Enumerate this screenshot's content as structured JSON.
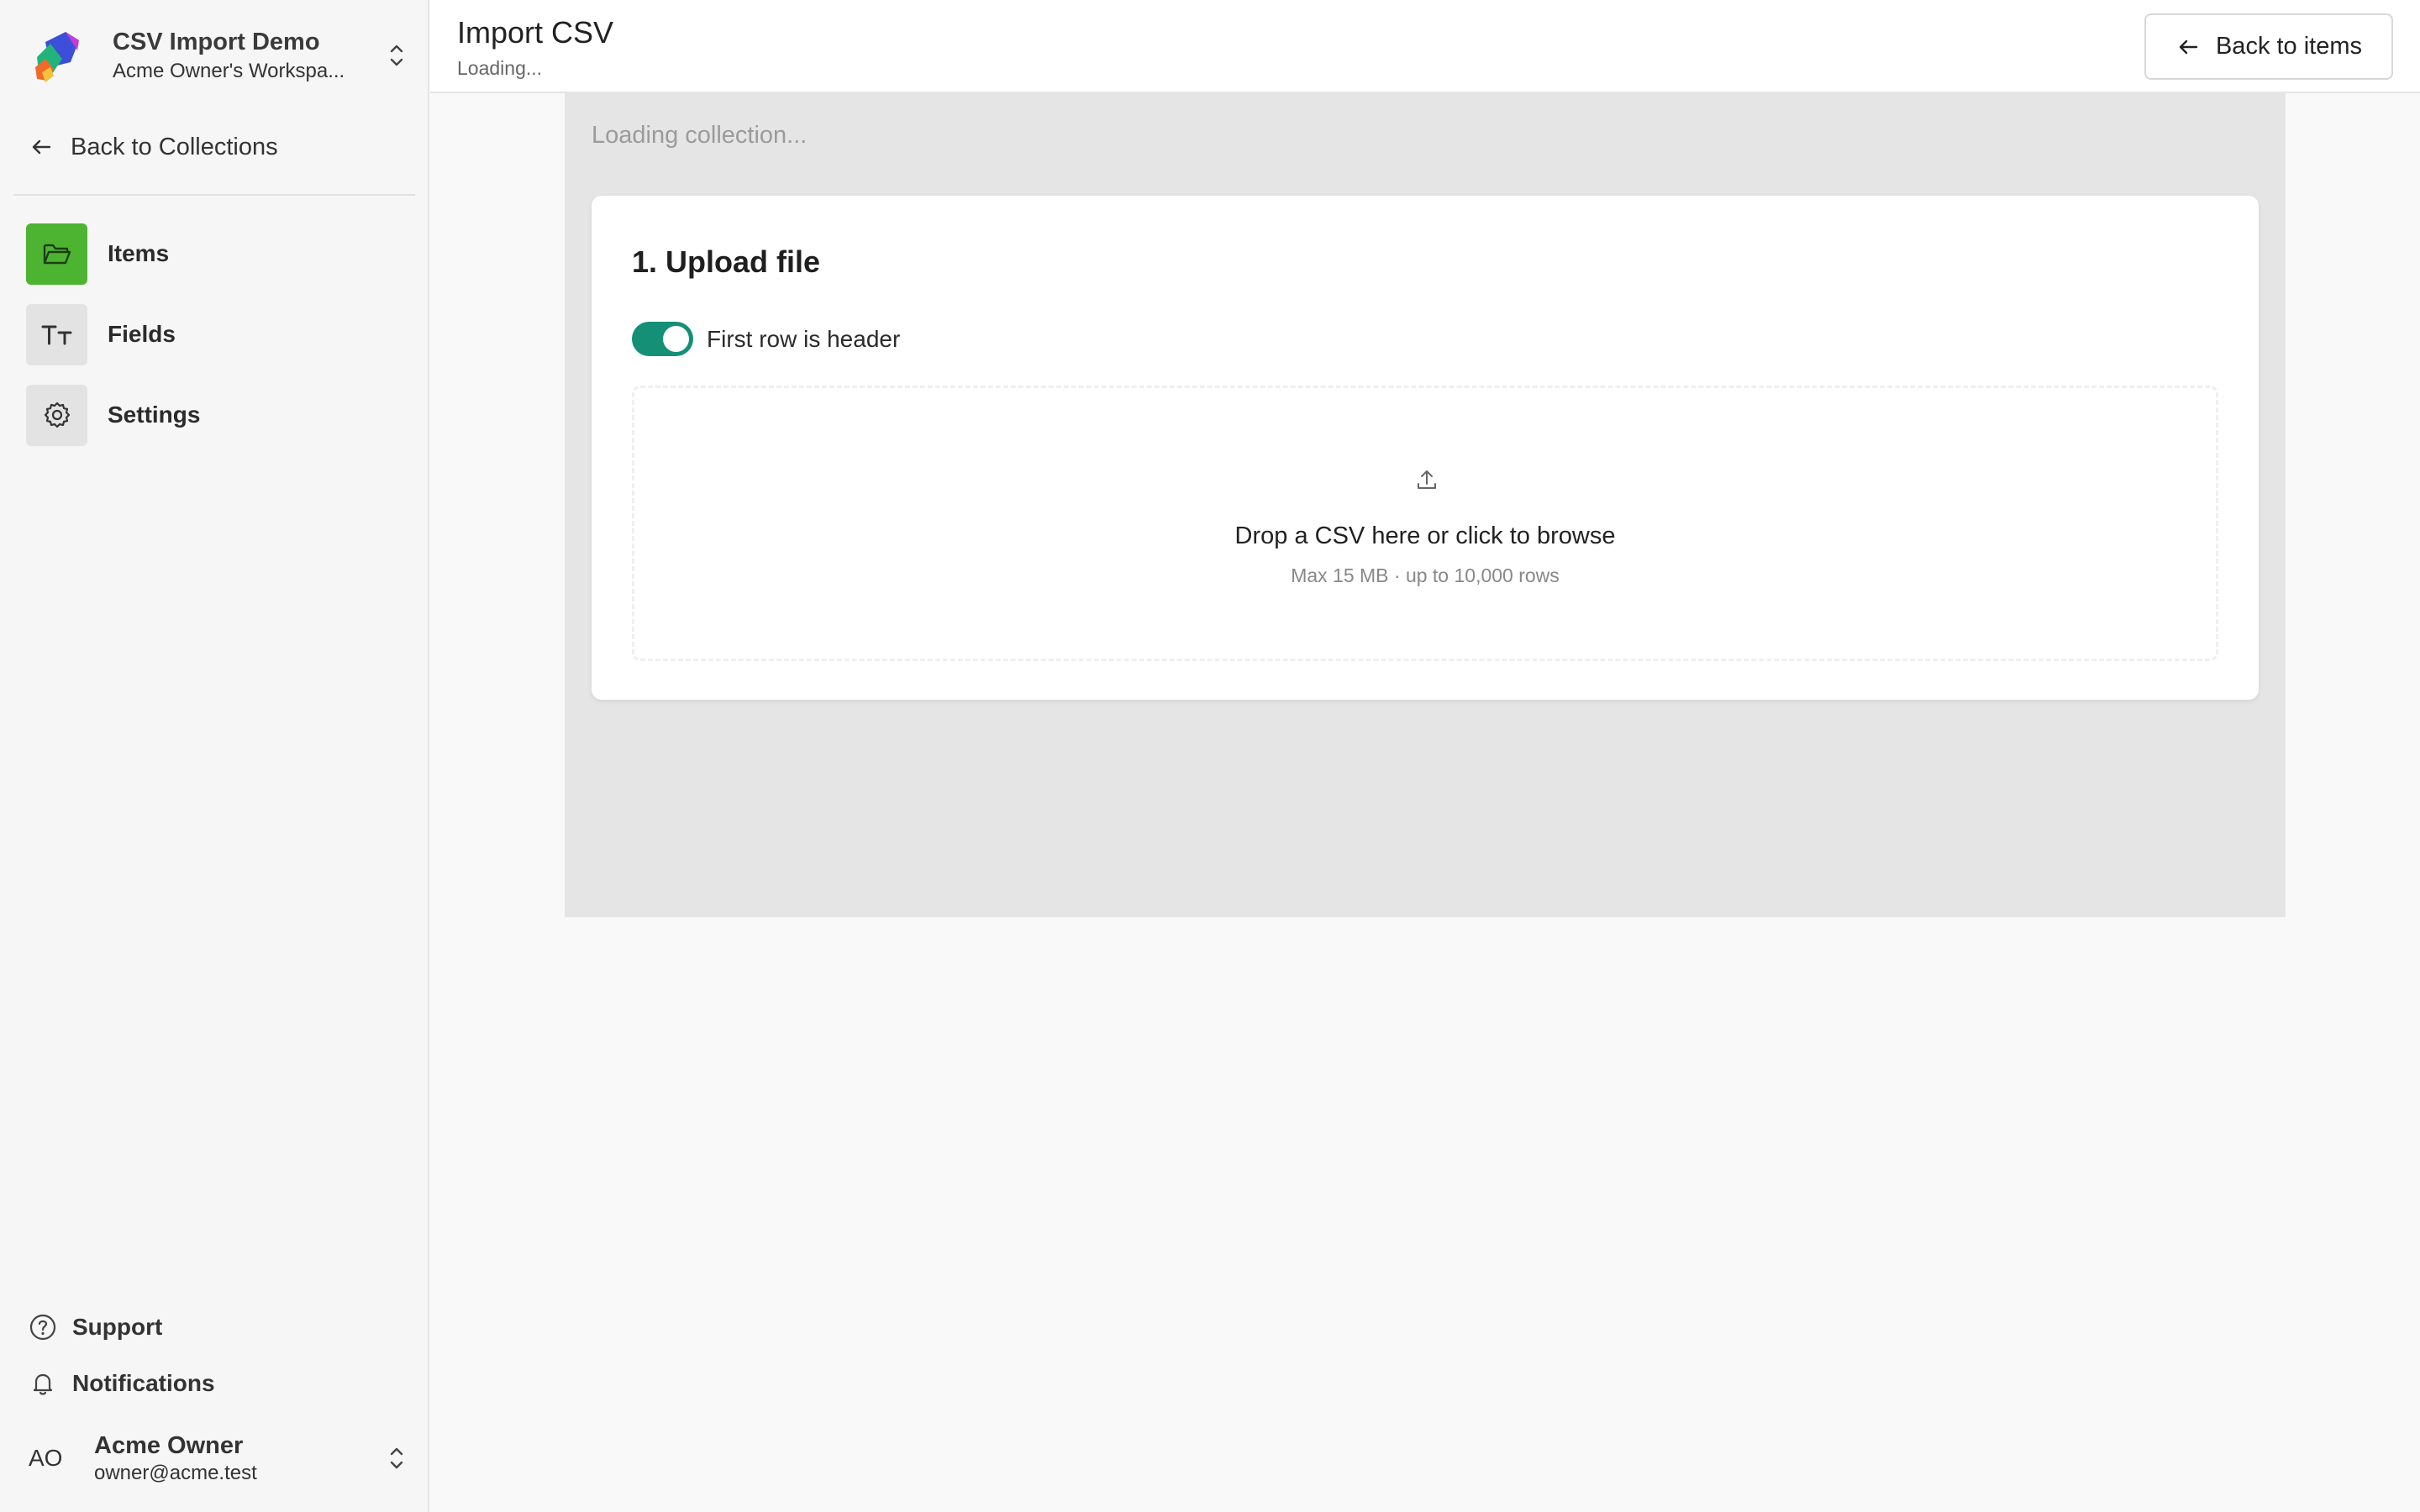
{
  "workspace": {
    "title": "CSV Import Demo",
    "subtitle": "Acme Owner's Workspa..."
  },
  "sidebar": {
    "back_label": "Back to Collections",
    "items": [
      {
        "label": "Items",
        "icon": "folder-icon",
        "active": true
      },
      {
        "label": "Fields",
        "icon": "text-type-icon",
        "active": false
      },
      {
        "label": "Settings",
        "icon": "gear-icon",
        "active": false
      }
    ],
    "support_label": "Support",
    "notifications_label": "Notifications"
  },
  "user": {
    "initials": "AO",
    "name": "Acme Owner",
    "email": "owner@acme.test"
  },
  "header": {
    "title": "Import CSV",
    "subtitle": "Loading...",
    "back_button_label": "Back to items"
  },
  "main": {
    "loading_text": "Loading collection...",
    "upload_card": {
      "title": "1. Upload file",
      "toggle_label": "First row is header",
      "toggle_on": true,
      "drop_text": "Drop a CSV here or click to browse",
      "drop_hint": "Max 15 MB · up to 10,000 rows"
    }
  },
  "colors": {
    "accent_green": "#4db431",
    "toggle_teal": "#149077",
    "panel_gray": "#e5e5e5"
  }
}
